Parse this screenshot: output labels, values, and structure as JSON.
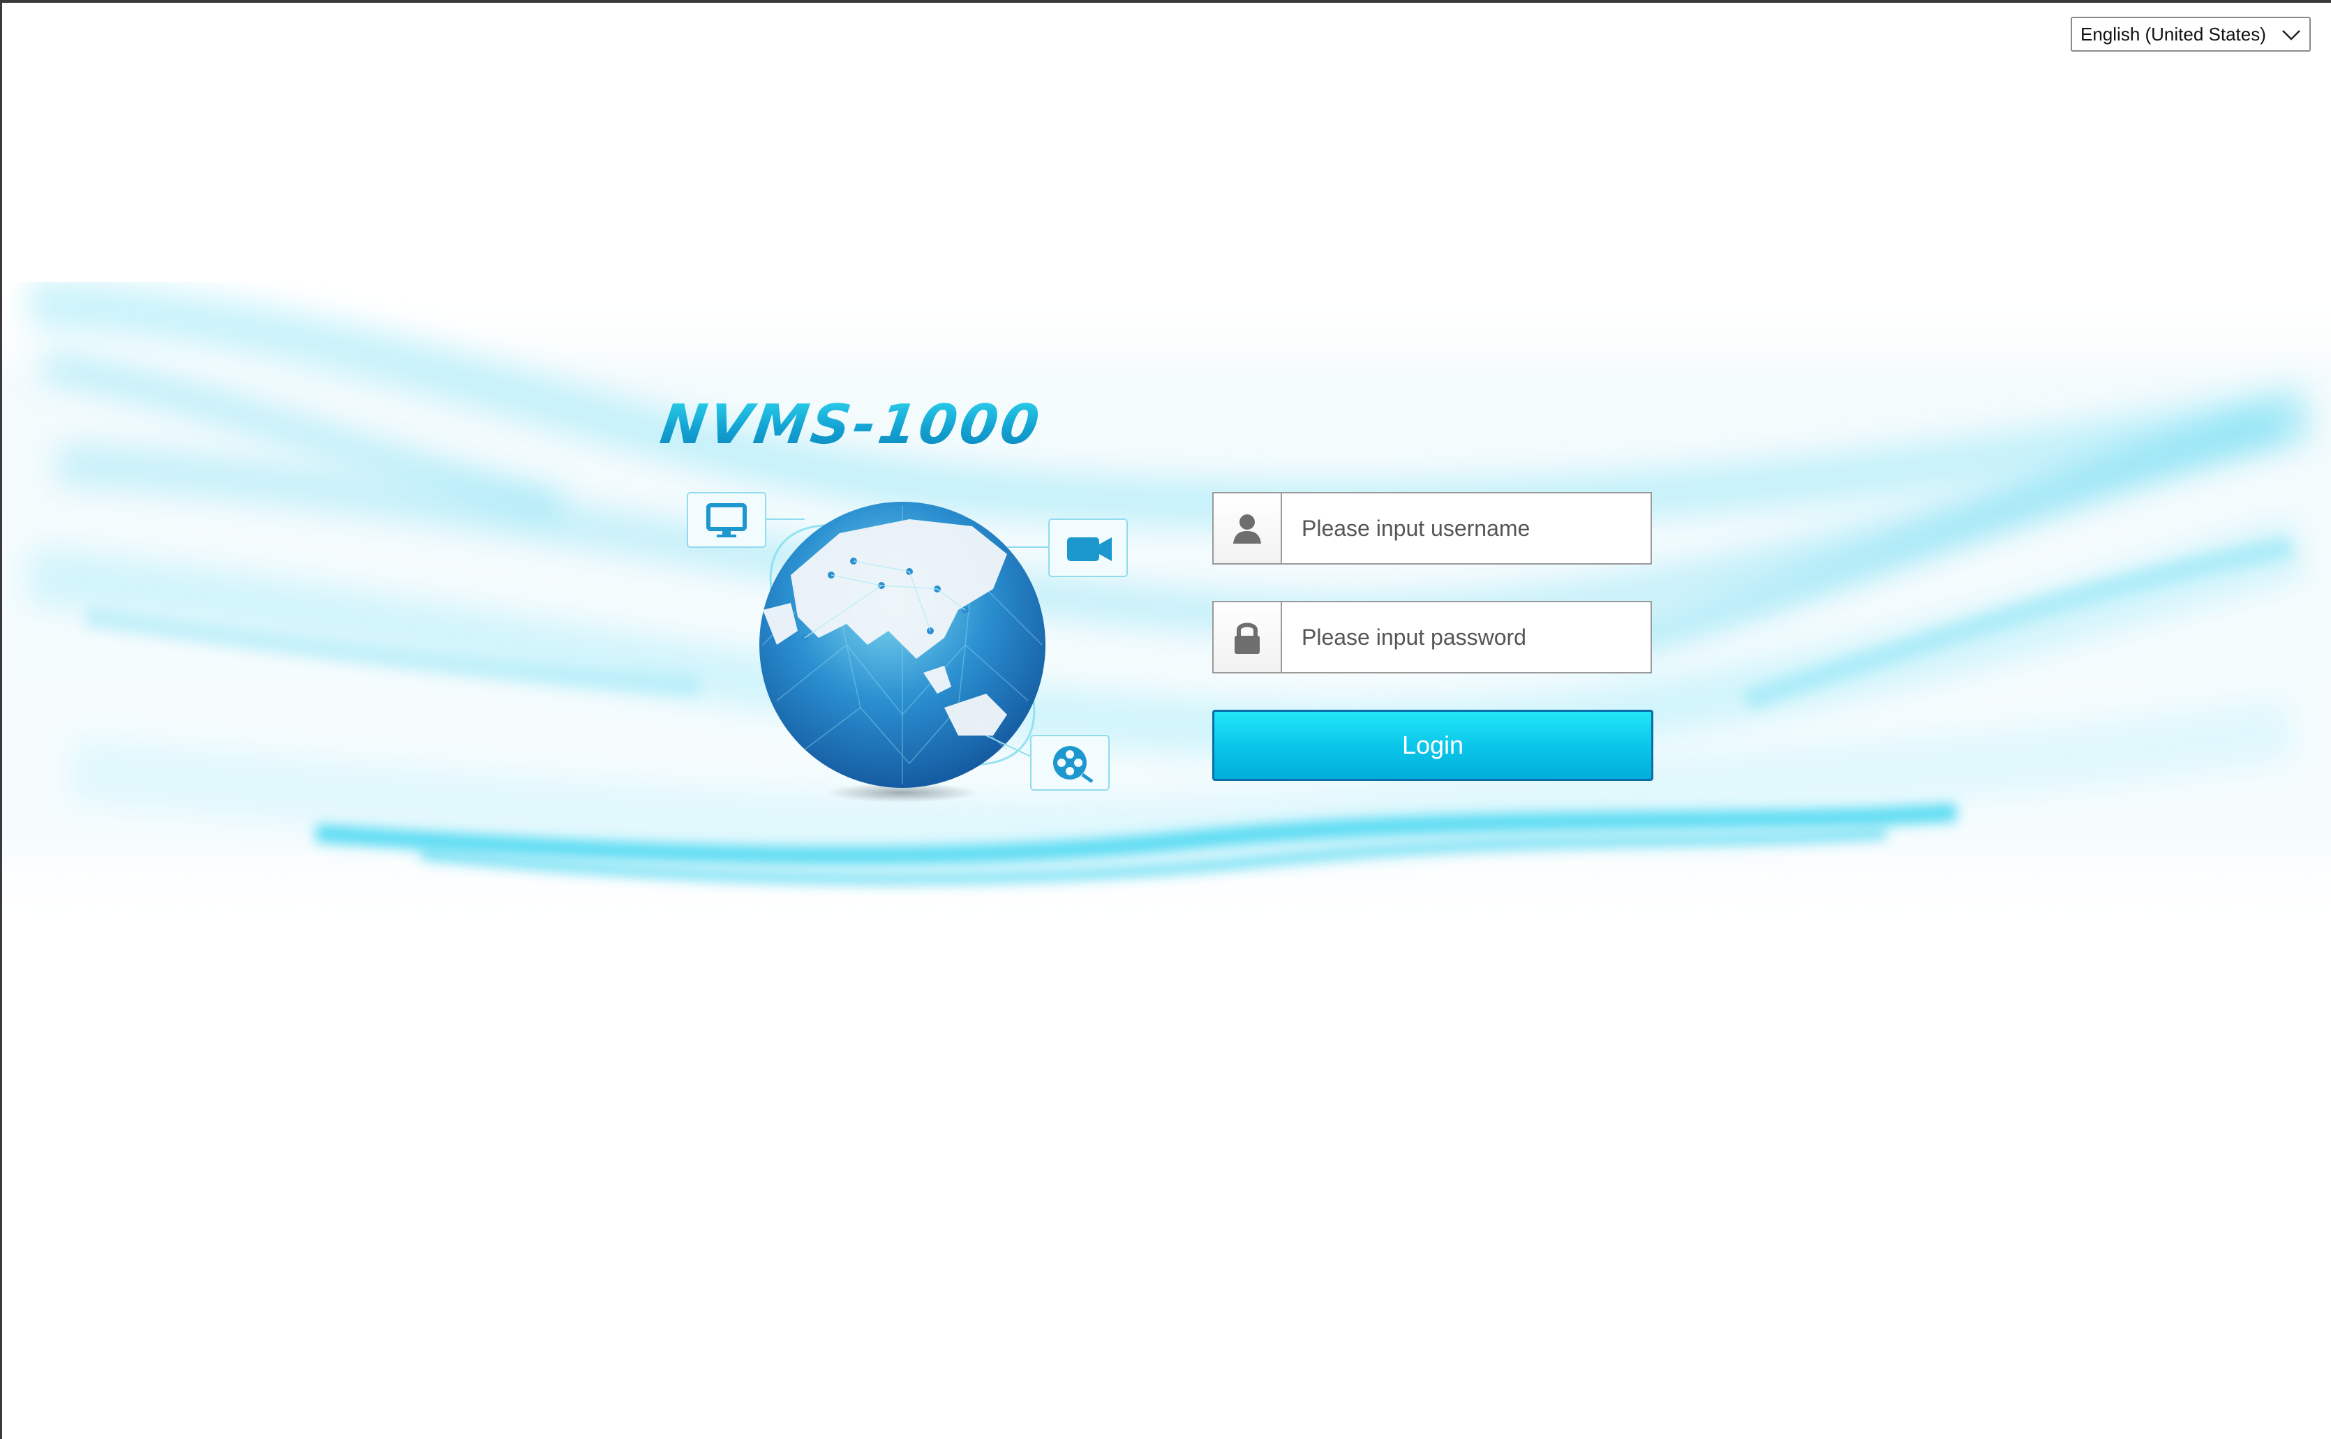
{
  "language": {
    "selected": "English (United States)",
    "icon": "chevron-down-icon"
  },
  "brand": {
    "logo_text": "NVMS-1000"
  },
  "login_form": {
    "username_placeholder": "Please input username",
    "password_placeholder": "Please input password",
    "username_icon": "user-icon",
    "password_icon": "lock-icon",
    "login_label": "Login"
  },
  "illustration": {
    "icons": [
      "monitor-icon",
      "video-camera-icon",
      "film-reel-icon",
      "globe-icon"
    ]
  },
  "colors": {
    "accent": "#0bc7ea",
    "brand": "#18a9d6",
    "button_border": "#0a6fa8"
  }
}
